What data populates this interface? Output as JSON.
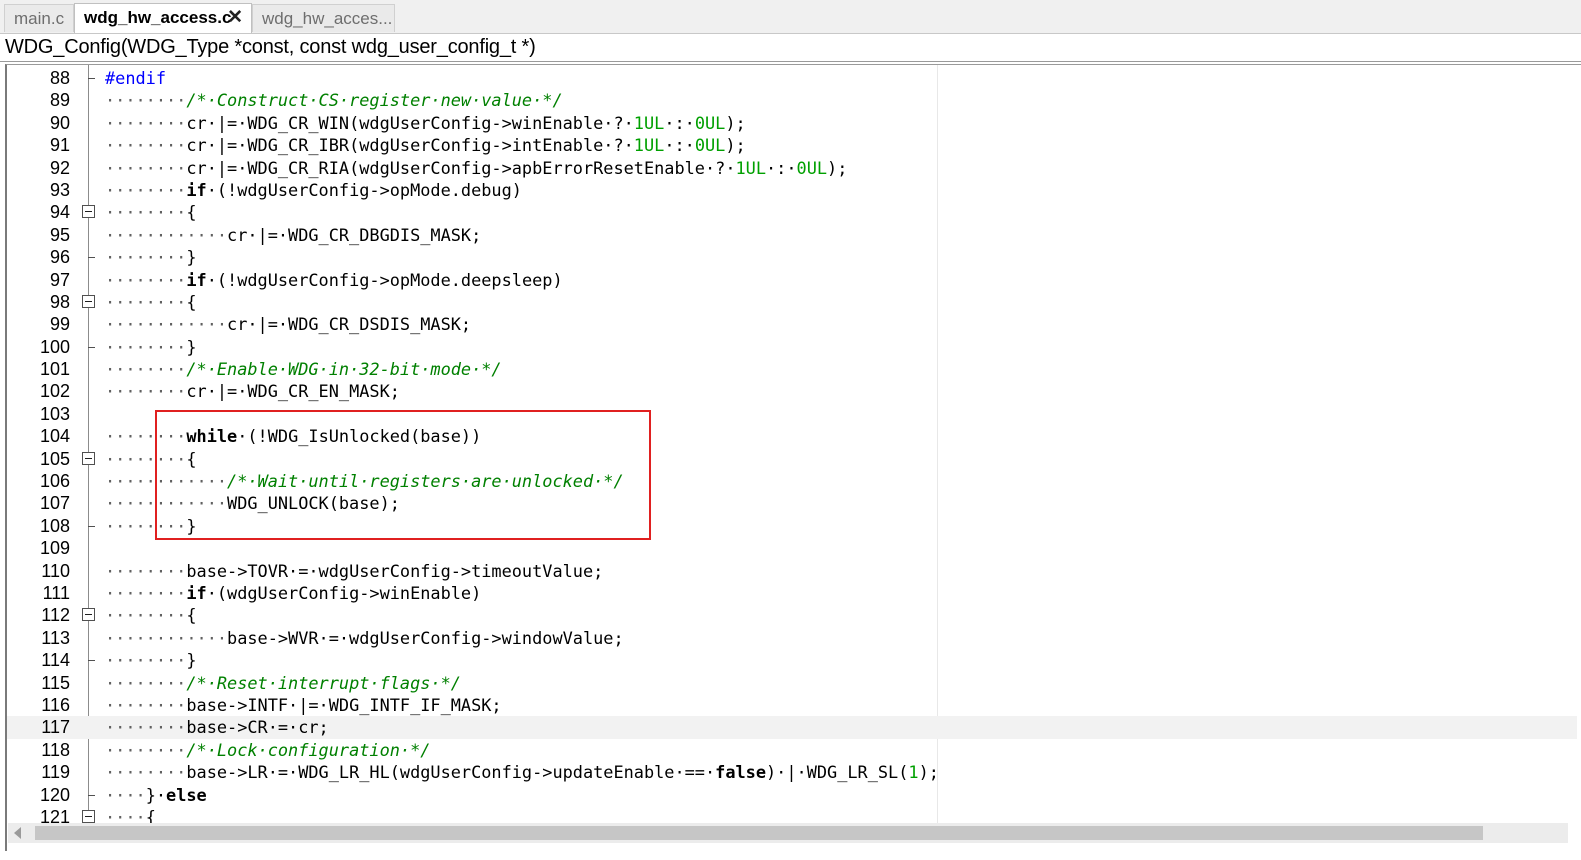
{
  "tabs": [
    {
      "label": "main.c",
      "active": false
    },
    {
      "label": "wdg_hw_access.c",
      "active": true,
      "close": "✕"
    },
    {
      "label": "wdg_hw_acces...",
      "active": false
    }
  ],
  "function_header": "WDG_Config(WDG_Type *const, const wdg_user_config_t *)",
  "editor": {
    "current_line": 117,
    "lines": [
      {
        "n": "88",
        "fold": "end"
      },
      {
        "n": "89",
        "fold": "none"
      },
      {
        "n": "90",
        "fold": "none"
      },
      {
        "n": "91",
        "fold": "none"
      },
      {
        "n": "92",
        "fold": "none"
      },
      {
        "n": "93",
        "fold": "none"
      },
      {
        "n": "94",
        "fold": "box"
      },
      {
        "n": "95",
        "fold": "none"
      },
      {
        "n": "96",
        "fold": "end"
      },
      {
        "n": "97",
        "fold": "none"
      },
      {
        "n": "98",
        "fold": "box"
      },
      {
        "n": "99",
        "fold": "none"
      },
      {
        "n": "100",
        "fold": "end"
      },
      {
        "n": "101",
        "fold": "none"
      },
      {
        "n": "102",
        "fold": "none"
      },
      {
        "n": "103",
        "fold": "none"
      },
      {
        "n": "104",
        "fold": "none"
      },
      {
        "n": "105",
        "fold": "box"
      },
      {
        "n": "106",
        "fold": "none"
      },
      {
        "n": "107",
        "fold": "none"
      },
      {
        "n": "108",
        "fold": "end"
      },
      {
        "n": "109",
        "fold": "none"
      },
      {
        "n": "110",
        "fold": "none"
      },
      {
        "n": "111",
        "fold": "none"
      },
      {
        "n": "112",
        "fold": "box"
      },
      {
        "n": "113",
        "fold": "none"
      },
      {
        "n": "114",
        "fold": "end"
      },
      {
        "n": "115",
        "fold": "none"
      },
      {
        "n": "116",
        "fold": "none"
      },
      {
        "n": "117",
        "fold": "none"
      },
      {
        "n": "118",
        "fold": "none"
      },
      {
        "n": "119",
        "fold": "none"
      },
      {
        "n": "120",
        "fold": "end"
      },
      {
        "n": "121",
        "fold": "box"
      }
    ],
    "code": {
      "l88": [
        [
          "pp",
          "#endif"
        ]
      ],
      "l89": [
        [
          "d",
          "········"
        ],
        [
          "cm",
          "/*·Construct·CS·register·new·value·*/"
        ]
      ],
      "l90": [
        [
          "d",
          "········"
        ],
        [
          "t",
          "cr·|=·WDG_CR_WIN(wdgUserConfig->winEnable·?·"
        ],
        [
          "num",
          "1UL"
        ],
        [
          "t",
          "·:·"
        ],
        [
          "num",
          "0UL"
        ],
        [
          "t",
          ");"
        ]
      ],
      "l91": [
        [
          "d",
          "········"
        ],
        [
          "t",
          "cr·|=·WDG_CR_IBR(wdgUserConfig->intEnable·?·"
        ],
        [
          "num",
          "1UL"
        ],
        [
          "t",
          "·:·"
        ],
        [
          "num",
          "0UL"
        ],
        [
          "t",
          ");"
        ]
      ],
      "l92": [
        [
          "d",
          "········"
        ],
        [
          "t",
          "cr·|=·WDG_CR_RIA(wdgUserConfig->apbErrorResetEnable·?·"
        ],
        [
          "num",
          "1UL"
        ],
        [
          "t",
          "·:·"
        ],
        [
          "num",
          "0UL"
        ],
        [
          "t",
          ");"
        ]
      ],
      "l93": [
        [
          "d",
          "········"
        ],
        [
          "kw",
          "if"
        ],
        [
          "t",
          "·(!wdgUserConfig->opMode.debug)"
        ]
      ],
      "l94": [
        [
          "d",
          "········"
        ],
        [
          "t",
          "{"
        ]
      ],
      "l95": [
        [
          "d",
          "············"
        ],
        [
          "t",
          "cr·|=·WDG_CR_DBGDIS_MASK;"
        ]
      ],
      "l96": [
        [
          "d",
          "········"
        ],
        [
          "t",
          "}"
        ]
      ],
      "l97": [
        [
          "d",
          "········"
        ],
        [
          "kw",
          "if"
        ],
        [
          "t",
          "·(!wdgUserConfig->opMode.deepsleep)"
        ]
      ],
      "l98": [
        [
          "d",
          "········"
        ],
        [
          "t",
          "{"
        ]
      ],
      "l99": [
        [
          "d",
          "············"
        ],
        [
          "t",
          "cr·|=·WDG_CR_DSDIS_MASK;"
        ]
      ],
      "l100": [
        [
          "d",
          "········"
        ],
        [
          "t",
          "}"
        ]
      ],
      "l101": [
        [
          "d",
          "········"
        ],
        [
          "cm",
          "/*·Enable·WDG·in·32-bit·mode·*/"
        ]
      ],
      "l102": [
        [
          "d",
          "········"
        ],
        [
          "t",
          "cr·|=·WDG_CR_EN_MASK;"
        ]
      ],
      "l103": [],
      "l104": [
        [
          "d",
          "········"
        ],
        [
          "kw",
          "while"
        ],
        [
          "t",
          "·(!WDG_IsUnlocked(base))"
        ]
      ],
      "l105": [
        [
          "d",
          "········"
        ],
        [
          "t",
          "{"
        ]
      ],
      "l106": [
        [
          "d",
          "············"
        ],
        [
          "cm",
          "/*·Wait·until·registers·are·unlocked·*/"
        ]
      ],
      "l107": [
        [
          "d",
          "············"
        ],
        [
          "t",
          "WDG_UNLOCK(base);"
        ]
      ],
      "l108": [
        [
          "d",
          "········"
        ],
        [
          "t",
          "}"
        ]
      ],
      "l109": [],
      "l110": [
        [
          "d",
          "········"
        ],
        [
          "t",
          "base->TOVR·=·wdgUserConfig->timeoutValue;"
        ]
      ],
      "l111": [
        [
          "d",
          "········"
        ],
        [
          "kw",
          "if"
        ],
        [
          "t",
          "·(wdgUserConfig->winEnable)"
        ]
      ],
      "l112": [
        [
          "d",
          "········"
        ],
        [
          "t",
          "{"
        ]
      ],
      "l113": [
        [
          "d",
          "············"
        ],
        [
          "t",
          "base->WVR·=·wdgUserConfig->windowValue;"
        ]
      ],
      "l114": [
        [
          "d",
          "········"
        ],
        [
          "t",
          "}"
        ]
      ],
      "l115": [
        [
          "d",
          "········"
        ],
        [
          "cm",
          "/*·Reset·interrupt·flags·*/"
        ]
      ],
      "l116": [
        [
          "d",
          "········"
        ],
        [
          "t",
          "base->INTF·|=·WDG_INTF_IF_MASK;"
        ]
      ],
      "l117": [
        [
          "d",
          "········"
        ],
        [
          "t",
          "base->CR·=·cr;"
        ]
      ],
      "l118": [
        [
          "d",
          "········"
        ],
        [
          "cm",
          "/*·Lock·configuration·*/"
        ]
      ],
      "l119": [
        [
          "d",
          "········"
        ],
        [
          "t",
          "base->LR·=·WDG_LR_HL(wdgUserConfig->updateEnable·==·"
        ],
        [
          "kw",
          "false"
        ],
        [
          "t",
          ")·|·WDG_LR_SL("
        ],
        [
          "num",
          "1"
        ],
        [
          "t",
          ");"
        ]
      ],
      "l120": [
        [
          "d",
          "····"
        ],
        [
          "t",
          "}·"
        ],
        [
          "kw",
          "else"
        ]
      ],
      "l121": [
        [
          "d",
          "····"
        ],
        [
          "t",
          "{"
        ]
      ]
    }
  },
  "highlight": {
    "from_line": 104,
    "to_line": 108,
    "color": "#e02020"
  },
  "scrollbar": {
    "orientation": "horizontal"
  }
}
